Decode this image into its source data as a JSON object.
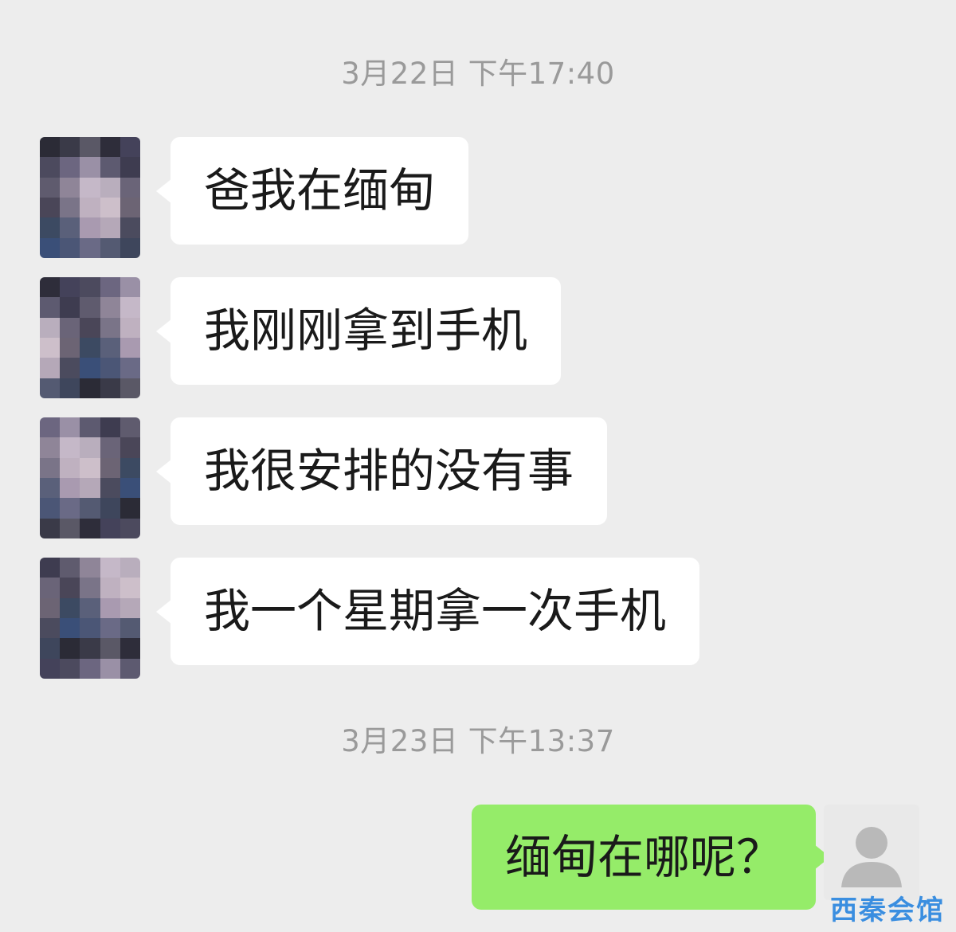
{
  "chat": {
    "timestamps": [
      {
        "text": "3月22日 下午17:40"
      },
      {
        "text": "3月23日 下午13:37"
      }
    ],
    "incoming_messages": [
      {
        "text": "爸我在缅甸"
      },
      {
        "text": "我刚刚拿到手机"
      },
      {
        "text": "我很安排的没有事"
      },
      {
        "text": "我一个星期拿一次手机"
      }
    ],
    "outgoing_messages": [
      {
        "text": "缅甸在哪呢？"
      }
    ]
  },
  "icons": {
    "contact_avatar": "avatar-pixelated-icon",
    "my_avatar": "default-user-avatar-icon"
  },
  "colors": {
    "background": "#ededed",
    "incoming_bubble": "#ffffff",
    "outgoing_bubble": "#95ec69",
    "timestamp_text": "#9a9a9a",
    "watermark": "#3a8ee0"
  },
  "watermark": {
    "text": "西秦会馆"
  }
}
